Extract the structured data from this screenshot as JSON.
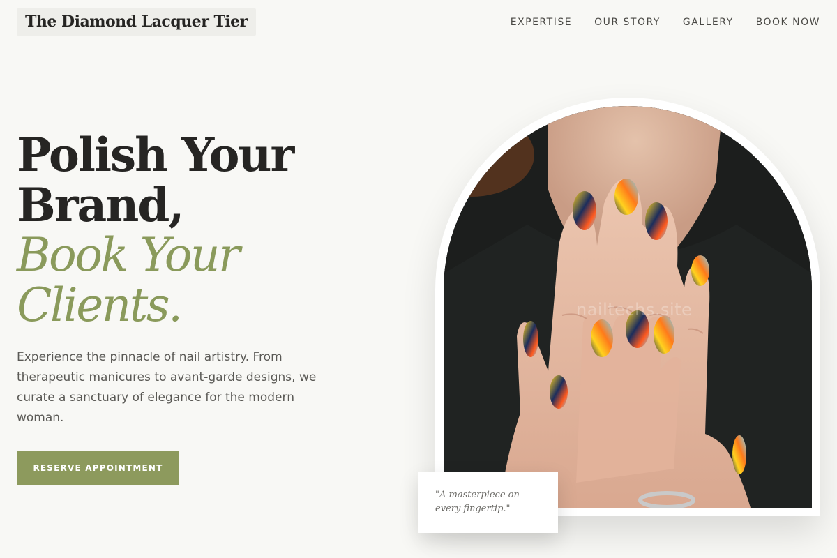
{
  "header": {
    "brand": "The Diamond Lacquer Tier",
    "nav": [
      "EXPERTISE",
      "OUR STORY",
      "GALLERY",
      "BOOK NOW"
    ]
  },
  "hero": {
    "title_line1": "Polish Your",
    "title_line2": "Brand,",
    "title_accent1": "Book Your",
    "title_accent2": "Clients.",
    "description": "Experience the pinnacle of nail artistry. From therapeutic manicures to avant-garde designs, we curate a sanctuary of elegance for the modern woman.",
    "cta_label": "RESERVE APPOINTMENT"
  },
  "image": {
    "alt": "hands with colorful abstract nail art",
    "watermark": "nailtechs.site"
  },
  "quote": {
    "text": "\"A masterpiece on every fingertip.\""
  },
  "colors": {
    "accent": "#8a9a5b",
    "button": "#8d9a5d",
    "background": "#f8f8f5",
    "heading": "#262523"
  }
}
